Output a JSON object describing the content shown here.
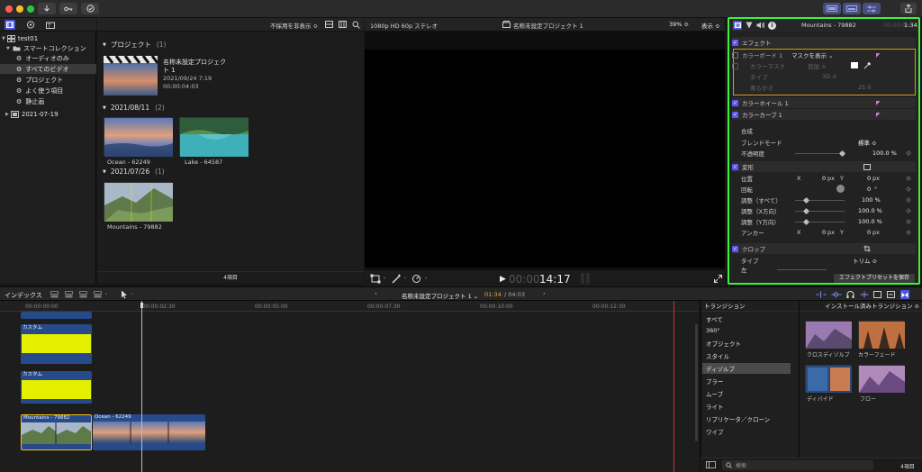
{
  "colors": {
    "accent": "#5a5af0",
    "highlight": "#3cf23c",
    "clip_yellow": "#e4f000",
    "clip_blue": "#274a8a"
  },
  "browser": {
    "filter_label": "不採用を非表示 ≎",
    "sections": [
      {
        "title": "プロジェクト",
        "count": "(1)"
      },
      {
        "title": "2021/08/11",
        "count": "(2)"
      },
      {
        "title": "2021/07/26",
        "count": "(1)"
      }
    ],
    "project": {
      "name_line1": "名称未設定プロジェク",
      "name_line2": "ト 1",
      "date": "2021/09/24 7:19",
      "duration": "00:00:04:03"
    },
    "clips": [
      {
        "label": "Ocean - 62249"
      },
      {
        "label": "Lake - 64587"
      },
      {
        "label": "Mountains - 79882"
      }
    ],
    "footer": "4項目"
  },
  "library": {
    "items": [
      {
        "label": "test01"
      },
      {
        "label": "スマートコレクション"
      },
      {
        "label": "オーディオのみ"
      },
      {
        "label": "すべてのビデオ"
      },
      {
        "label": "プロジェクト"
      },
      {
        "label": "よく使う項目"
      },
      {
        "label": "静止画"
      },
      {
        "label": "2021-07-19"
      }
    ]
  },
  "viewer": {
    "format": "1080p HD 60p ステレオ",
    "project": "名称未設定プロジェクト 1",
    "zoom": "39% ≎",
    "view": "表示 ≎",
    "timecode_dim": "00:00",
    "timecode": "14:17"
  },
  "inspector": {
    "clip_name": "Mountains - 79882",
    "time_dim": "00:00:0",
    "time": "1:34",
    "effects_label": "エフェクト",
    "color_board": "カラーボード 1",
    "mask_label": "マスクを表示 ⌄",
    "color_mask": "カラーマスク",
    "add_label": "追加 ≎",
    "type_label": "タイプ",
    "type_value": "3D ≎",
    "softness_label": "柔らかさ",
    "softness_value": "25.0",
    "color_wheel": "カラーホイール 1",
    "color_curve": "カラーカーブ 1",
    "composite": "合成",
    "blend_mode": "ブレンドモード",
    "blend_value": "標準 ≎",
    "opacity": "不透明度",
    "opacity_value": "100.0 %",
    "transform": "変形",
    "position": "位置",
    "x": "X",
    "y": "Y",
    "zero": "0",
    "px": "px",
    "rotation": "回転",
    "deg": "°",
    "scale_all": "調整（すべて）",
    "scale_all_value": "100 %",
    "scale_x": "調整（X方向）",
    "scale_x_value": "100.0 %",
    "scale_y": "調整（Y方向）",
    "scale_y_value": "100.0 %",
    "anchor": "アンカー",
    "crop": "クロップ",
    "crop_type": "タイプ",
    "crop_value": "トリム ≎",
    "cut_label": "左",
    "save_preset": "エフェクトプリセットを保存"
  },
  "timeline": {
    "index": "インデックス",
    "project": "名称未設定プロジェクト 1 ⌄",
    "time": "01:34",
    "duration": "/ 04:03",
    "ticks": [
      "00:00:00:00",
      "00:00:02:30",
      "00:00:05:00",
      "00:00:07:30",
      "00:00:10:00",
      "00:00:12:30"
    ],
    "custom1": "カスタム",
    "custom2": "カスタム",
    "clip_mountains": "Mountains - 79882",
    "clip_ocean": "Ocean - 62249"
  },
  "transitions": {
    "header": "トランジション",
    "installed": "インストール済みトランジション ≎",
    "categories": [
      "すべて",
      "360°",
      "オブジェクト",
      "スタイル",
      "ディゾルブ",
      "ブラー",
      "ムーブ",
      "ライト",
      "リプリケータ／クローン",
      "ワイプ"
    ],
    "items": [
      "クロスディゾルブ",
      "カラーフェード",
      "ディバイド",
      "フロー"
    ],
    "count": "4項目",
    "search_placeholder": "検索"
  }
}
